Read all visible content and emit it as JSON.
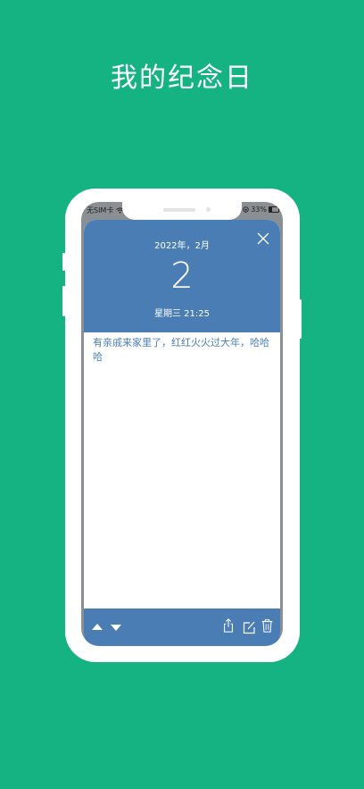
{
  "promo": {
    "headline": "我的纪念日"
  },
  "status_bar": {
    "carrier": "无SIM卡",
    "battery": "33%"
  },
  "entry": {
    "year_month": "2022年，2月",
    "day": "2",
    "weekday_time": "星期三 21:25",
    "note": "有亲戚来家里了，红红火火过大年，哈哈哈"
  },
  "icons": {
    "close": "close-icon",
    "prev": "triangle-up-icon",
    "next": "triangle-down-icon",
    "share": "share-icon",
    "edit": "edit-icon",
    "delete": "trash-icon"
  },
  "colors": {
    "background": "#15b381",
    "accent": "#4a7db4"
  }
}
